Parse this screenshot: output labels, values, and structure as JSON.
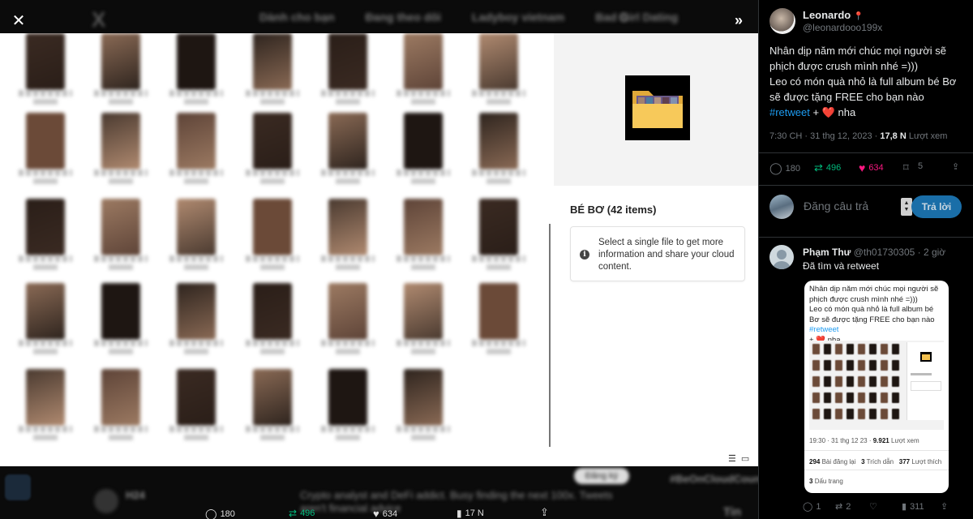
{
  "background": {
    "tabs": [
      "Dành cho bạn",
      "Đang theo dõi",
      "Ladyboy vietnam",
      "Bad Girl Dating"
    ],
    "blur_items": {
      "post_author": "H24",
      "bio": "Crypto analyst and DeFi addict. Busy finding the next 100x. Tweets aren't financial advice",
      "follow": "Đăng ký",
      "trend": "#BeOnCloudCount",
      "trend2": "Tin nổi"
    },
    "stats": {
      "replies": "180",
      "retweets": "496",
      "likes": "634",
      "views": "17 N"
    }
  },
  "viewer": {
    "close_icon": "close-icon",
    "expand_icon": "chevrons-right-icon",
    "folder": {
      "title": "BÉ BƠ (42 items)",
      "info": "Select a single file to get more information and share your cloud content."
    }
  },
  "tweet": {
    "author": {
      "name": "Leonardo",
      "handle": "@leonardooo199x",
      "badge": "📍"
    },
    "text_lines": [
      "Nhân dịp năm mới chúc mọi người sẽ phịch được crush mình nhé =)))",
      "Leo có món quà nhỏ là full album bé Bơ sẽ được tặng FREE cho bạn nào"
    ],
    "hashtag": "#retweet",
    "plus": "+",
    "heart": "❤️",
    "tail": "nha",
    "time": "7:30 CH · 31 thg 12, 2023 ·",
    "views": "17,8 N",
    "views_label": "Lượt xem",
    "actions": {
      "replies": "180",
      "retweets": "496",
      "likes": "634",
      "bookmarks": "5"
    },
    "reply_placeholder": "Đăng câu trả",
    "reply_button": "Trả lời"
  },
  "reply": {
    "name": "Phạm Thư",
    "handle": "@th01730305 · 2 giờ",
    "text": "Đã tìm và retweet",
    "quote": {
      "line1": "Nhân dịp năm mới chúc mọi người sẽ phịch được crush mình nhé =)))",
      "line2": "Leo có món quà nhỏ là full album bé Bơ sẽ được tặng FREE cho bạn nào",
      "hashtag": "#retweet",
      "plus_heart_prefix": "+",
      "heart": "❤️",
      "tail": "nha",
      "time": "19:30 · 31 thg 12 23 ·",
      "views": "9.921",
      "views_label": "Lượt xem",
      "reposts": "294",
      "reposts_label": "Bài đăng lại",
      "quotes": "3",
      "quotes_label": "Trích dẫn",
      "likes": "377",
      "likes_label": "Lượt thích",
      "bookmarks": "3",
      "bookmarks_label": "Dấu trang"
    },
    "actions": {
      "replies": "1",
      "retweets": "2",
      "views": "311"
    }
  },
  "colors": {
    "accent": "#1d9bf0",
    "like": "#f91880",
    "retweet": "#00ba7c",
    "muted": "#71767b"
  }
}
